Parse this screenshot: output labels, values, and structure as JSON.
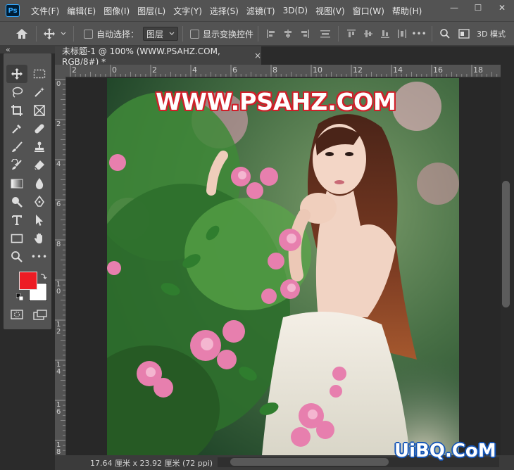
{
  "app": {
    "logo": "Ps"
  },
  "menu": [
    "文件(F)",
    "编辑(E)",
    "图像(I)",
    "图层(L)",
    "文字(Y)",
    "选择(S)",
    "滤镜(T)",
    "3D(D)",
    "视图(V)",
    "窗口(W)",
    "帮助(H)"
  ],
  "window_controls": {
    "minimize": "—",
    "maximize": "☐",
    "close": "✕"
  },
  "options_bar": {
    "auto_select_label": "自动选择：",
    "auto_select_value": "图层",
    "show_transform_label": "显示变换控件",
    "mode_3d_label": "3D 模式"
  },
  "document_tab": {
    "title": "未标题-1 @ 100% (WWW.PSAHZ.COM, RGB/8#) *",
    "close": "×"
  },
  "ruler_h_labels": [
    "2",
    "0",
    "2",
    "4",
    "6",
    "8",
    "10",
    "12",
    "14",
    "16",
    "18"
  ],
  "ruler_v_labels": [
    "0",
    "2",
    "4",
    "6",
    "8",
    "1\n0",
    "1\n2",
    "1\n4",
    "1\n6",
    "1\n8"
  ],
  "status": {
    "doc_size": "17.64 厘米 x 23.92 厘米 (72 ppi)",
    "arrow": "›"
  },
  "canvas": {
    "watermark_top": "WWW.PSAHZ.COM"
  },
  "site_watermark": "UiBQ.CoM",
  "colors": {
    "foreground": "#ed1c24",
    "background": "#ffffff",
    "accent": "#31a8ff"
  },
  "tools": [
    "move-tool",
    "marquee-tool",
    "lasso-tool",
    "magic-wand-tool",
    "crop-tool",
    "frame-tool",
    "eyedropper-tool",
    "healing-brush-tool",
    "brush-tool",
    "stamp-tool",
    "history-brush-tool",
    "eraser-tool",
    "gradient-tool",
    "blur-tool",
    "dodge-tool",
    "pen-tool",
    "type-tool",
    "path-select-tool",
    "shape-tool",
    "hand-tool",
    "zoom-tool",
    "more-tools"
  ]
}
